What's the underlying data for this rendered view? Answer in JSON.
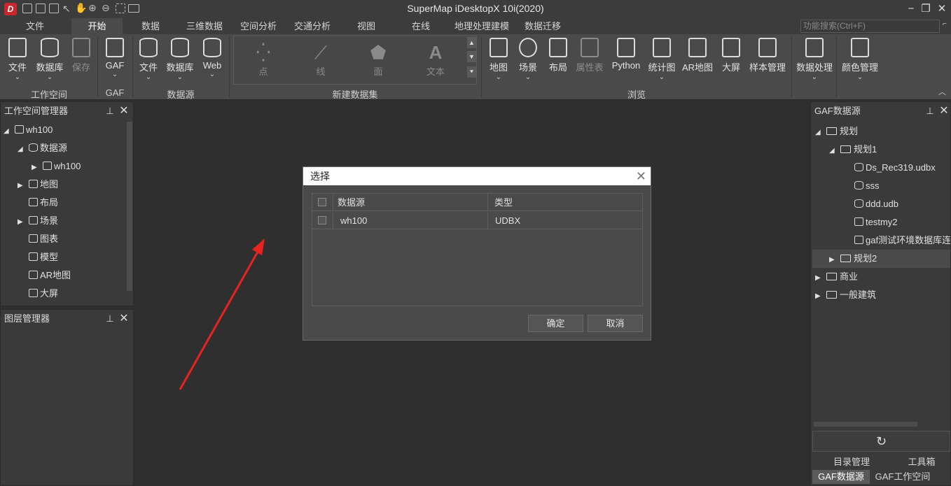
{
  "window": {
    "title": "SuperMap iDesktopX 10i(2020)",
    "logo_letter": "D"
  },
  "menu": {
    "tabs": [
      "文件",
      "开始",
      "数据",
      "三维数据",
      "空间分析",
      "交通分析",
      "视图",
      "在线",
      "地理处理建模",
      "数据迁移"
    ],
    "active_tab": "开始",
    "search_placeholder": "功能搜索(Ctrl+F)"
  },
  "ribbon": {
    "workspace": {
      "file": "文件",
      "database": "数据库",
      "save": "保存",
      "group": "工作空间"
    },
    "gaf": {
      "gaf": "GAF",
      "group": "GAF"
    },
    "datasource": {
      "file": "文件",
      "database": "数据库",
      "web": "Web",
      "group": "数据源"
    },
    "new_dataset": {
      "point": "点",
      "line": "线",
      "region": "面",
      "text": "文本",
      "text_glyph": "A",
      "group": "新建数据集"
    },
    "browse": {
      "map": "地图",
      "scene": "场景",
      "layout": "布局",
      "attr_table": "属性表",
      "python": "Python",
      "stat_chart": "统计图",
      "ar_map": "AR地图",
      "big_screen": "大屏",
      "sample_mgmt": "样本管理",
      "group": "浏览"
    },
    "data_processing": "数据处理",
    "color_mgmt": "颜色管理"
  },
  "workspace_manager": {
    "title": "工作空间管理器",
    "nodes": {
      "root": "wh100",
      "datasources": "数据源",
      "ds_wh100": "wh100",
      "maps": "地图",
      "layouts": "布局",
      "scenes": "场景",
      "charts": "图表",
      "models": "模型",
      "ar_maps": "AR地图",
      "big_screens": "大屏"
    }
  },
  "layer_manager": {
    "title": "图层管理器"
  },
  "gaf_panel": {
    "title": "GAF数据源",
    "nodes": {
      "planning": "规划",
      "planning1": "规划1",
      "f1": "Ds_Rec319.udbx",
      "f2": "sss",
      "f3": "ddd.udb",
      "f4": "testmy2",
      "f5": "gaf测试环境数据库连",
      "planning2": "规划2",
      "commercial": "商业",
      "general_building": "一般建筑"
    },
    "refresh_glyph": "↻",
    "tabs_top": [
      "目录管理",
      "工具箱"
    ],
    "tabs_bottom": [
      "GAF数据源",
      "GAF工作空间"
    ]
  },
  "dialog": {
    "title": "选择",
    "columns": [
      "数据源",
      "类型"
    ],
    "rows": [
      {
        "name": "wh100",
        "type": "UDBX"
      }
    ],
    "ok": "确定",
    "cancel": "取消"
  },
  "colors": {
    "annotation_arrow": "#e8231f",
    "logo": "#c8282d"
  }
}
